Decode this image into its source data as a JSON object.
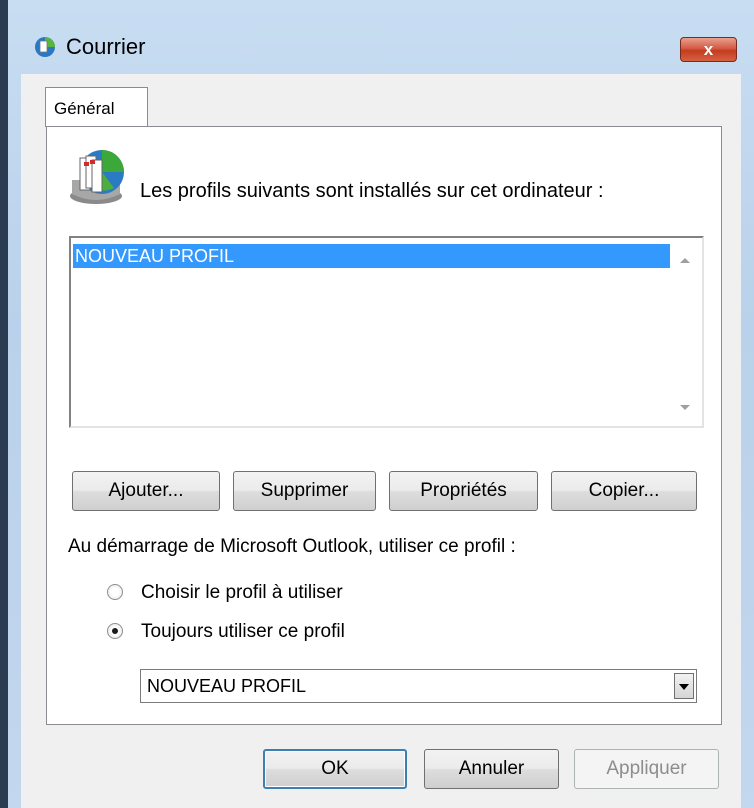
{
  "window": {
    "title": "Courrier",
    "close_label": "x"
  },
  "tabs": [
    {
      "label": "Général"
    }
  ],
  "panel": {
    "intro_text": "Les profils suivants sont installés sur cet ordinateur :",
    "profiles": [
      "NOUVEAU PROFIL"
    ],
    "buttons": {
      "add": "Ajouter...",
      "remove": "Supprimer",
      "properties": "Propriétés",
      "copy": "Copier..."
    },
    "startup_label": "Au démarrage de Microsoft Outlook, utiliser ce profil :",
    "radio_options": [
      {
        "label": "Choisir le profil à utiliser",
        "checked": false
      },
      {
        "label": "Toujours utiliser ce profil",
        "checked": true
      }
    ],
    "selected_profile": "NOUVEAU PROFIL"
  },
  "dialog_buttons": {
    "ok": "OK",
    "cancel": "Annuler",
    "apply": "Appliquer"
  },
  "colors": {
    "selection": "#3399ff",
    "close_button": "#c33d22"
  }
}
